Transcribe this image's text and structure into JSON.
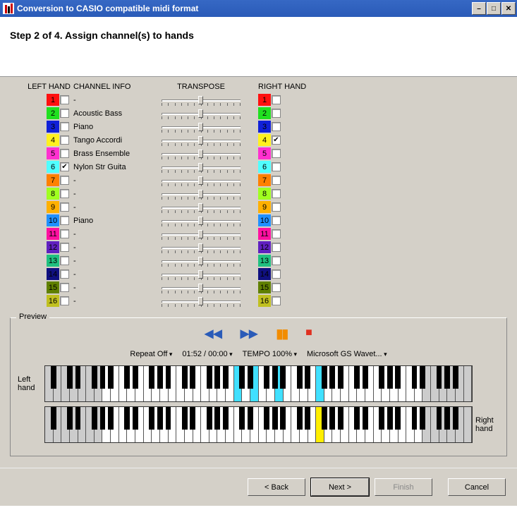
{
  "window": {
    "title": "Conversion to CASIO compatible midi format"
  },
  "header": {
    "step_title": "Step 2 of 4. Assign channel(s) to hands"
  },
  "columns": {
    "left_hand": "LEFT HAND",
    "channel_info": "CHANNEL INFO",
    "transpose": "TRANSPOSE",
    "right_hand": "RIGHT HAND"
  },
  "channels": [
    {
      "n": 1,
      "color": "#ff1010",
      "info": "-",
      "left": false,
      "right": false
    },
    {
      "n": 2,
      "color": "#20e020",
      "info": "Acoustic Bass",
      "left": false,
      "right": false
    },
    {
      "n": 3,
      "color": "#1020d8",
      "info": "Piano",
      "left": false,
      "right": false
    },
    {
      "n": 4,
      "color": "#fff020",
      "info": "Tango Accordi",
      "left": false,
      "right": true
    },
    {
      "n": 5,
      "color": "#ff30d0",
      "info": "Brass Ensemble",
      "left": false,
      "right": false
    },
    {
      "n": 6,
      "color": "#50ffff",
      "info": "Nylon Str Guita",
      "left": true,
      "right": false
    },
    {
      "n": 7,
      "color": "#ff8000",
      "info": "-",
      "left": false,
      "right": false
    },
    {
      "n": 8,
      "color": "#a0ff20",
      "info": "-",
      "left": false,
      "right": false
    },
    {
      "n": 9,
      "color": "#ffb000",
      "info": "-",
      "left": false,
      "right": false
    },
    {
      "n": 10,
      "color": "#2090ff",
      "info": "Piano",
      "left": false,
      "right": false
    },
    {
      "n": 11,
      "color": "#ff10a0",
      "info": "-",
      "left": false,
      "right": false
    },
    {
      "n": 12,
      "color": "#6020c0",
      "info": "-",
      "left": false,
      "right": false
    },
    {
      "n": 13,
      "color": "#20c080",
      "info": "-",
      "left": false,
      "right": false
    },
    {
      "n": 14,
      "color": "#101080",
      "info": "-",
      "left": false,
      "right": false
    },
    {
      "n": 15,
      "color": "#608000",
      "info": "-",
      "left": false,
      "right": false
    },
    {
      "n": 16,
      "color": "#c0c020",
      "info": "-",
      "left": false,
      "right": false
    }
  ],
  "preview": {
    "title": "Preview",
    "repeat": "Repeat Off",
    "time": "01:52 / 00:00",
    "tempo": "TEMPO 100%",
    "device": "Microsoft GS Wavet...",
    "left_label": "Left hand",
    "right_label": "Right hand",
    "left_highlights": {
      "white": [
        23,
        25,
        28,
        33
      ],
      "black_between_white": [
        32
      ]
    },
    "right_highlights": {
      "white": [
        33
      ],
      "black_between_white": []
    },
    "white_key_count": 52,
    "inactive_low_count": 7,
    "inactive_high_count": 6
  },
  "buttons": {
    "back": "< Back",
    "next": "Next >",
    "finish": "Finish",
    "cancel": "Cancel"
  }
}
